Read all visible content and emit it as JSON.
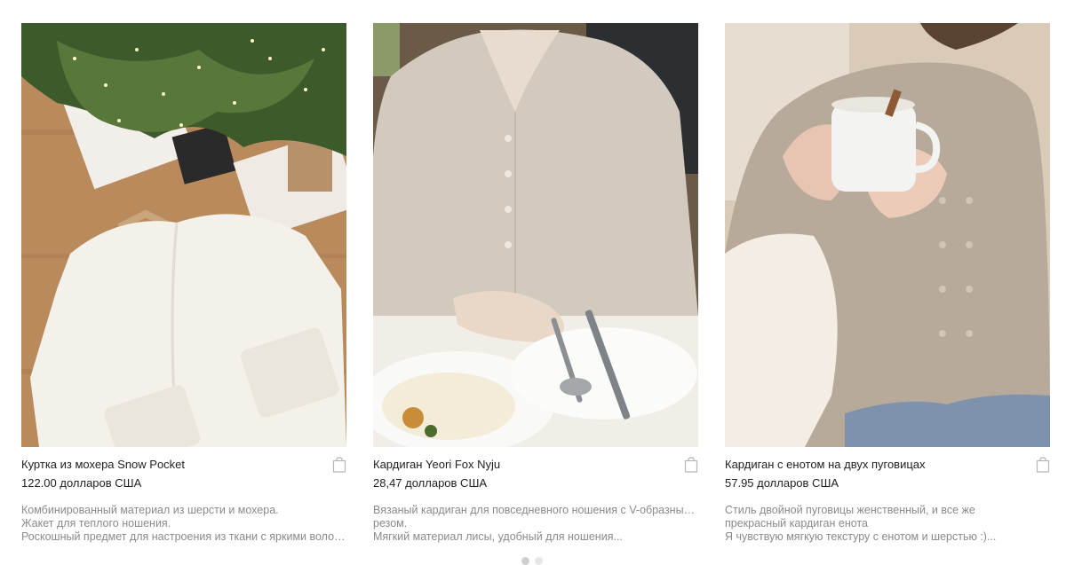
{
  "products": [
    {
      "image_alt": "Куртка из мохера Snow Pocket",
      "title": "Куртка из мохера Snow Pocket",
      "price": "122.00 долларов США",
      "description": [
        "Комбинированный материал из шерсти и мохера.",
        "Жакет для теплого ношения.",
        "Роскошный предмет для настроения из ткани с яркими волоса..."
      ],
      "cart_icon": "shopping-bag-icon"
    },
    {
      "image_alt": "Кардиган Yeori Fox Nyju",
      "title": "Кардиган Yeori Fox Nyju",
      "price": "28,47 долларов США",
      "description": [
        "Вязаный кардиган для повседневного ношения с V-образным вы",
        "резом.",
        "Мягкий материал лисы, удобный для ношения..."
      ],
      "cart_icon": "shopping-bag-icon"
    },
    {
      "image_alt": "Кардиган с енотом на двух пуговицах",
      "title": "Кардиган с енотом на двух пуговицах",
      "price": "57.95 долларов США",
      "description": [
        "Стиль двойной пуговицы женственный, и все же",
        "прекрасный кардиган енота",
        "Я чувствую мягкую текстуру с енотом и шерстью :)..."
      ],
      "cart_icon": "shopping-bag-icon"
    }
  ],
  "pagination": {
    "active_index": 0,
    "count": 2
  },
  "colors": {
    "title": "#1f1f1f",
    "description": "#8a8a8a",
    "icon": "#b5b5b5"
  }
}
